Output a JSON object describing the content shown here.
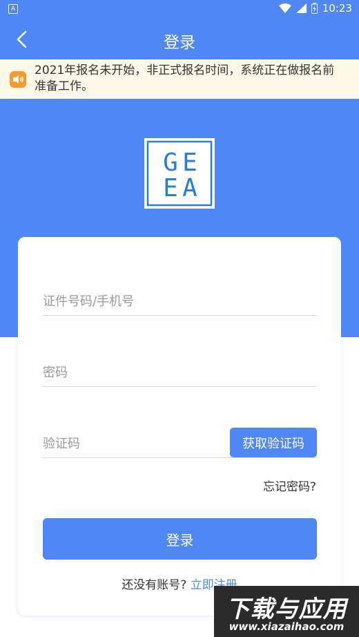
{
  "status_bar": {
    "notification_letter": "A",
    "time": "10:23",
    "icons": [
      "wifi-icon",
      "signal-icon",
      "battery-icon"
    ]
  },
  "header": {
    "title": "登录",
    "back_icon": "chevron-left-icon"
  },
  "notice": {
    "icon": "speaker-icon",
    "text_line1": "2021年报名未开始，非正式报名时间，系统正在做报名前",
    "text_line2": "准备工作。"
  },
  "logo": {
    "letters": [
      "G",
      "E",
      "E",
      "A"
    ]
  },
  "form": {
    "id_placeholder": "证件号码/手机号",
    "password_placeholder": "密码",
    "code_placeholder": "验证码",
    "get_code_label": "获取验证码",
    "forgot_label": "忘记密码?",
    "login_label": "登录",
    "no_account_text": "还没有账号?",
    "register_label": "立即注册"
  },
  "watermark": {
    "main": "下载与应用",
    "url": "www.xiazaihao.com"
  },
  "colors": {
    "primary": "#4f87f5",
    "notice_bg": "#fdf8e8",
    "notice_icon": "#f59b2f"
  }
}
